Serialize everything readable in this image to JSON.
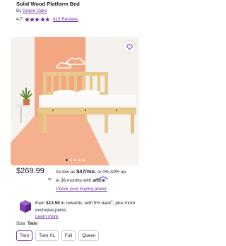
{
  "product": {
    "title": "Solid Wood Platform Bed",
    "by_prefix": "By",
    "brand": "Gracie Oaks",
    "rating_value": "4.7",
    "rating_stars": 4.7,
    "reviews_link": "815 Reviews"
  },
  "image": {
    "carousel_dots": 5,
    "active_dot": 0,
    "favorite_icon": "heart-icon"
  },
  "pricing": {
    "price": "$269.99",
    "as_low_as": "As low as",
    "monthly": "$47/mo.",
    "apr_text": "or 0% APR up",
    "or_small": "or",
    "term_text": "to 36 months with",
    "affirm": "affirm",
    "power_link": "Check your buying power"
  },
  "rewards": {
    "earn_prefix": "Earn",
    "amount": "$13.50",
    "text_rest": "in rewards, with 5% back",
    "sup": "1",
    "text_end": ", plus more exclusive perks",
    "learn_more": "Learn more"
  },
  "size": {
    "label": "Size:",
    "selected": "Twin",
    "options": [
      "Twin",
      "Twin XL",
      "Full",
      "Queen"
    ]
  },
  "colors": {
    "accent": "#6b2d9e",
    "wall_orange": "#f2a682",
    "rewards_icon": "#7b3fb0"
  }
}
